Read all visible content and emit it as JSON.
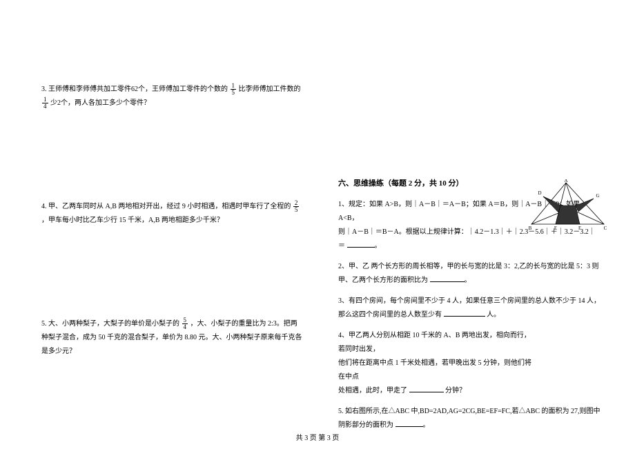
{
  "left": {
    "p3_a": "3. 王师傅和李师傅共加工零件62个，王师傅加工零件的个数的",
    "p3_f1n": "1",
    "p3_f1d": "5",
    "p3_b": "比李师傅加工件数的",
    "p3_f2n": "1",
    "p3_f2d": "4",
    "p3_c": "少2个，两人各加工多少个零件？",
    "p4_a": "4. 甲、乙两车同时从 A,B 两地相对开出，经过 9 小时相遇，相遇时甲车行了全程的",
    "p4_f1n": "2",
    "p4_f1d": "5",
    "p4_b": "，甲车每小时比乙车少行 15 千米，A,B 两地相距多少千米？",
    "p5_a": "5. 大、小两种梨子，大梨子的单价是小梨子的",
    "p5_f1n": "5",
    "p5_f1d": "4",
    "p5_b": "，大、小梨子的重量比为 2:3。把两种梨子混合，成为 50 千克的混合梨子，单价为 8.80 元。大、小两种梨子原来每千克各是多少元？"
  },
  "right": {
    "section": "六、思维操练（每题 2 分，共 10 分）",
    "p1_a": "1、规定：如果 A>B，则｜A－B｜＝A－B；如果 A＝B，则｜A－B｜＝0；如果 A<B，",
    "p1_b": "则｜A－B｜＝B－A。根据以上规律计算：｜4.2－1.3｜＋｜2.3－5.6｜＋｜3.2－3.2｜＝",
    "p2": "2、甲、乙 两个长方形的周长相等，甲的长与宽的比是 3：2,乙的长与宽的比是 5：3 则甲、乙两个长方形的面积比为",
    "p3_a": "3、有四个房间，每个房间里不少于 4 人，如果任意三个房间里的总人数不少于 14 人，那么这四个房间里的总人数至少有",
    "p3_b": "人。",
    "p4_a": "4、甲乙两人分别从相距 10 千米的 A、B 两地出发，相向而行，若同时出发，",
    "p4_b": "他们将在距离中点 1 千米处相遇，若甲晚出发 5 分钟，则他们将在中点",
    "p4_c": "处相遇，此时，甲走了",
    "p4_d": "分钟？",
    "p5_a": "5. 如右图所示,在△ABC 中,BD=2AD,AG=2CG,BE=EF=FC,若△ABC 的面积为 27,则图中阴影部分的面积为"
  },
  "fig_labels": {
    "A": "A",
    "B": "B",
    "C": "C",
    "D": "D",
    "E": "E",
    "F": "F",
    "G": "G"
  },
  "footer": "共 3 页    第 3 页"
}
